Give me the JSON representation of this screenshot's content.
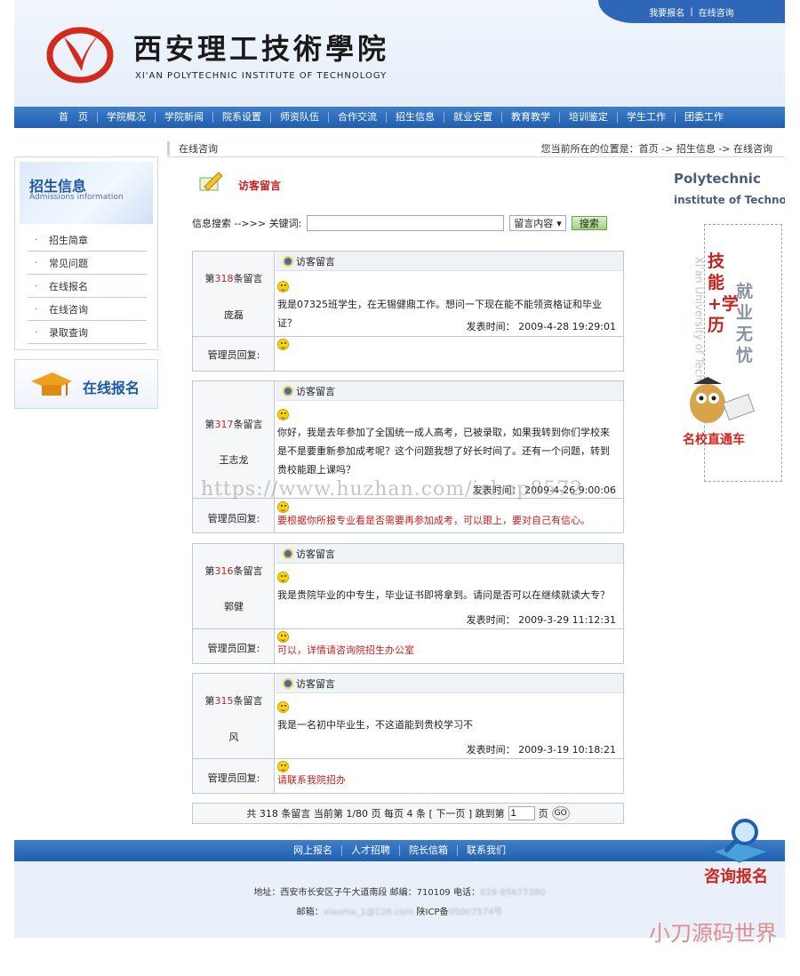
{
  "header": {
    "top_links": [
      "我要报名",
      "|",
      "在线咨询"
    ],
    "logo_cn": "西安理工技術學院",
    "logo_en": "XI'AN POLYTECHNIC INSTITUTE OF TECHNOLOGY"
  },
  "nav": [
    "首　页",
    "学院概况",
    "学院新闻",
    "院系设置",
    "师资队伍",
    "合作交流",
    "招生信息",
    "就业安置",
    "教育教学",
    "培训鉴定",
    "学生工作",
    "团委工作"
  ],
  "sidebar": {
    "title": "招生信息",
    "subtitle": "Admissions information",
    "items": [
      "招生简章",
      "常见问题",
      "在线报名",
      "在线咨询",
      "录取查询"
    ],
    "apply_banner": "在线报名"
  },
  "breadcrumb": {
    "section": "在线咨询",
    "path": "您当前所在的位置是：首页 -> 招生信息 -> 在线咨询"
  },
  "guestbook": {
    "title": "访客留言",
    "search_label": "信息搜索 -->>> 关键词:",
    "search_value": "",
    "search_select": "留言内容",
    "search_button": "搜索"
  },
  "messages": [
    {
      "num_prefix": "第",
      "num": "318",
      "num_suffix": "条留言",
      "author": "庞磊",
      "header": "访客留言",
      "content": "我是07325班学生，在无锡健鼎工作。想问一下现在能不能领资格证和毕业证？",
      "time": "发表时间：  2009-4-28 19:29:01",
      "reply_label": "管理员回复:",
      "reply": ""
    },
    {
      "num_prefix": "第",
      "num": "317",
      "num_suffix": "条留言",
      "author": "王志龙",
      "header": "访客留言",
      "content": "你好，我是去年参加了全国统一成人高考，已被录取，如果我转到你们学校来是不是要重新参加成考呢？这个问题我想了好长时间了。还有一个问题，转到贵校能跟上课吗？",
      "time": "发表时间：  2009-4-26 9:00:06",
      "reply_label": "管理员回复:",
      "reply": "要根据你所报专业看是否需要再参加成考，可以跟上，要对自己有信心。"
    },
    {
      "num_prefix": "第",
      "num": "316",
      "num_suffix": "条留言",
      "author": "郭健",
      "header": "访客留言",
      "content": "我是贵院毕业的中专生，毕业证书即将拿到。请问是否可以在继续就读大专？",
      "time": "发表时间：  2009-3-29 11:12:31",
      "reply_label": "管理员回复:",
      "reply": "可以，详情请咨询院招生办公室"
    },
    {
      "num_prefix": "第",
      "num": "315",
      "num_suffix": "条留言",
      "author": "风",
      "header": "访客留言",
      "content": "我是一名初中毕业生，不这道能到贵校学习不",
      "time": "发表时间：  2009-3-19 10:18:21",
      "reply_label": "管理员回复:",
      "reply": "请联系我院招办"
    }
  ],
  "pager": {
    "text": "共 318 条留言 当前第 1/80 页 每页 4 条 [ 下一页 ] 跳到第",
    "page_value": "1",
    "suffix": "页",
    "go": "GO"
  },
  "right_ad": {
    "en1": "Polytechnic",
    "en2": "institute of Technology",
    "vertical": "Xi'an University of Technology",
    "slogan_red": "技能+学历",
    "slogan_grey": "就业无忧",
    "tag": "名校直通车"
  },
  "footer": {
    "links": [
      "网上报名",
      "人才招聘",
      "院长信箱",
      "联系我们"
    ],
    "line1": "地址：西安市长安区子午大道南段  邮编：710109 电话：",
    "line1_blur": "029-85677380",
    "line2_prefix": "邮箱：",
    "line2_blur": "xiaoma_1@126.com",
    "line2_suffix": "  陕ICP备",
    "line2_blur2": "05007574号"
  },
  "consult_badge": "咨询报名",
  "watermark": "https://www.huzhan.com/ishop8572",
  "corner_mark": "小刀源码世界"
}
